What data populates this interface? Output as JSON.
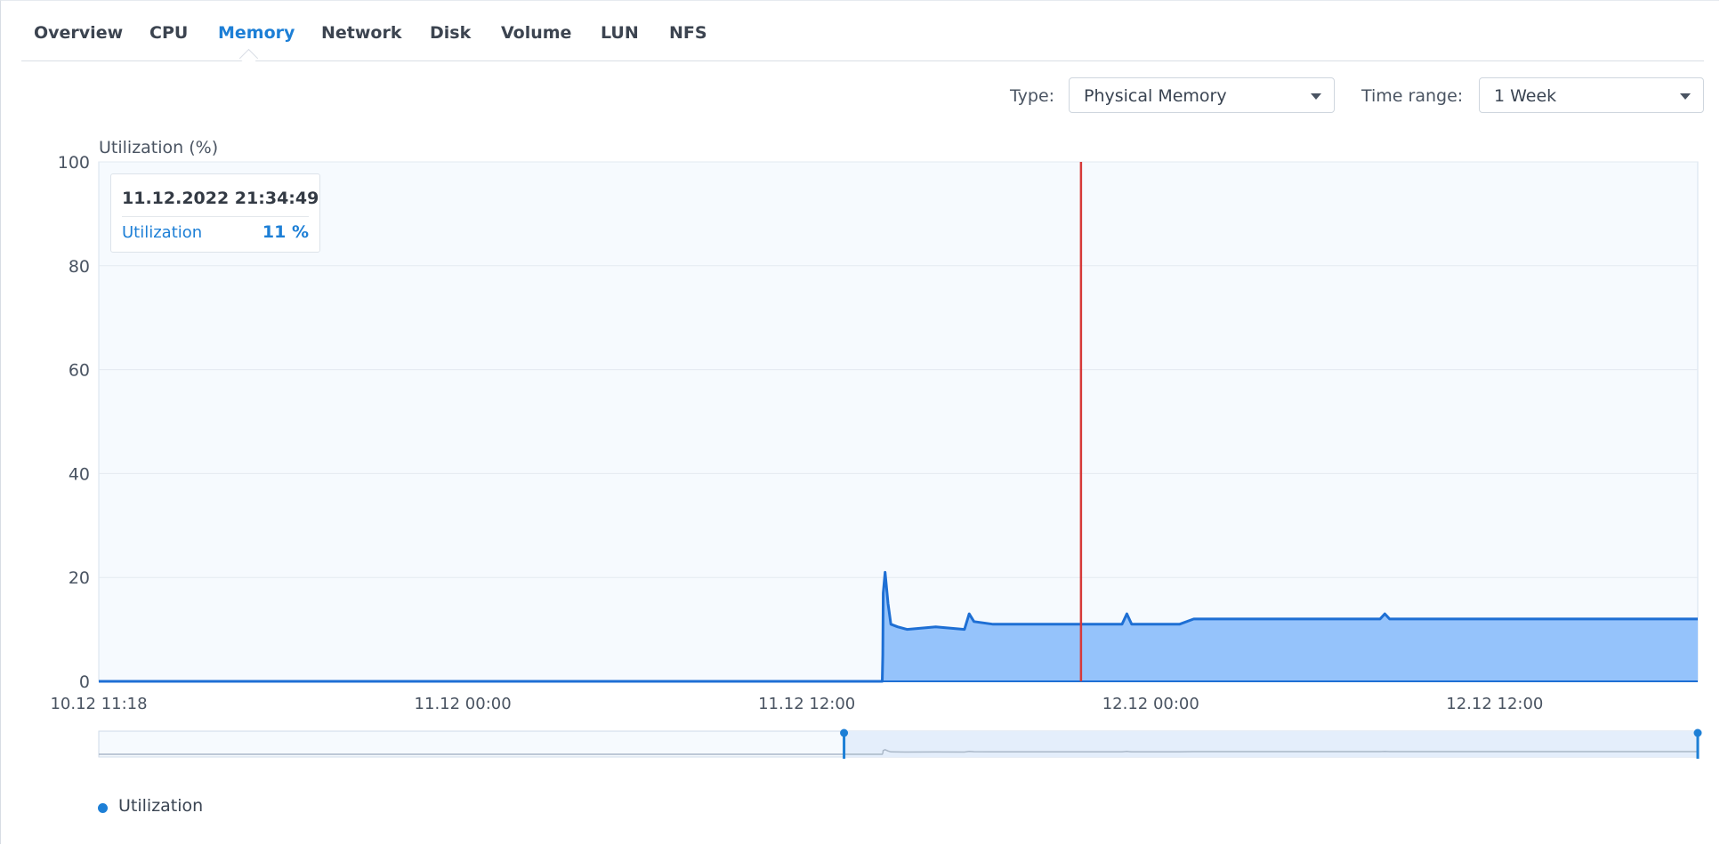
{
  "tabs": [
    {
      "label": "Overview"
    },
    {
      "label": "CPU"
    },
    {
      "label": "Memory",
      "active": true
    },
    {
      "label": "Network"
    },
    {
      "label": "Disk"
    },
    {
      "label": "Volume"
    },
    {
      "label": "LUN"
    },
    {
      "label": "NFS"
    }
  ],
  "controls": {
    "type_label": "Type:",
    "type_value": "Physical Memory",
    "time_range_label": "Time range:",
    "time_range_value": "1 Week"
  },
  "tooltip": {
    "time": "11.12.2022 21:34:49",
    "series": "Utilization",
    "value": "11 %"
  },
  "legend": {
    "label": "Utilization"
  },
  "colors": {
    "accent": "#1d7fd6",
    "line": "#1e6fd4",
    "area": "#95c3fb",
    "cursor": "#d63a3a",
    "plot_bg": "#f6fafe"
  },
  "chart_data": {
    "type": "area",
    "ylabel": "Utilization (%)",
    "ylim": [
      0,
      100
    ],
    "yticks": [
      0,
      20,
      40,
      60,
      80,
      100
    ],
    "x_axis_ticks": [
      "10.12 11:18",
      "11.12 00:00",
      "11.12 12:00",
      "12.12 00:00",
      "12.12 12:00"
    ],
    "x_start": "10.12 11:18",
    "x_end": "12.12 19:05",
    "cursor_x": "11.12 21:34",
    "grid": true,
    "legend_position": "bottom-left",
    "series": [
      {
        "name": "Utilization",
        "points": [
          [
            "10.12 11:18",
            0
          ],
          [
            "11.12 14:38",
            0
          ],
          [
            "11.12 14:39",
            5
          ],
          [
            "11.12 14:40",
            17
          ],
          [
            "11.12 14:44",
            21
          ],
          [
            "11.12 14:50",
            15
          ],
          [
            "11.12 14:56",
            11
          ],
          [
            "11.12 15:10",
            10.5
          ],
          [
            "11.12 15:30",
            10
          ],
          [
            "11.12 16:30",
            10.5
          ],
          [
            "11.12 17:30",
            10
          ],
          [
            "11.12 17:40",
            13
          ],
          [
            "11.12 17:50",
            11.5
          ],
          [
            "11.12 18:30",
            11
          ],
          [
            "11.12 19:30",
            11
          ],
          [
            "11.12 21:34",
            11
          ],
          [
            "11.12 23:00",
            11
          ],
          [
            "11.12 23:10",
            13
          ],
          [
            "11.12 23:20",
            11
          ],
          [
            "12.12 01:00",
            11
          ],
          [
            "12.12 01:30",
            12
          ],
          [
            "12.12 03:00",
            12
          ],
          [
            "12.12 08:00",
            12
          ],
          [
            "12.12 08:10",
            13
          ],
          [
            "12.12 08:20",
            12
          ],
          [
            "12.12 12:00",
            12
          ],
          [
            "12.12 19:05",
            12
          ]
        ]
      }
    ]
  }
}
